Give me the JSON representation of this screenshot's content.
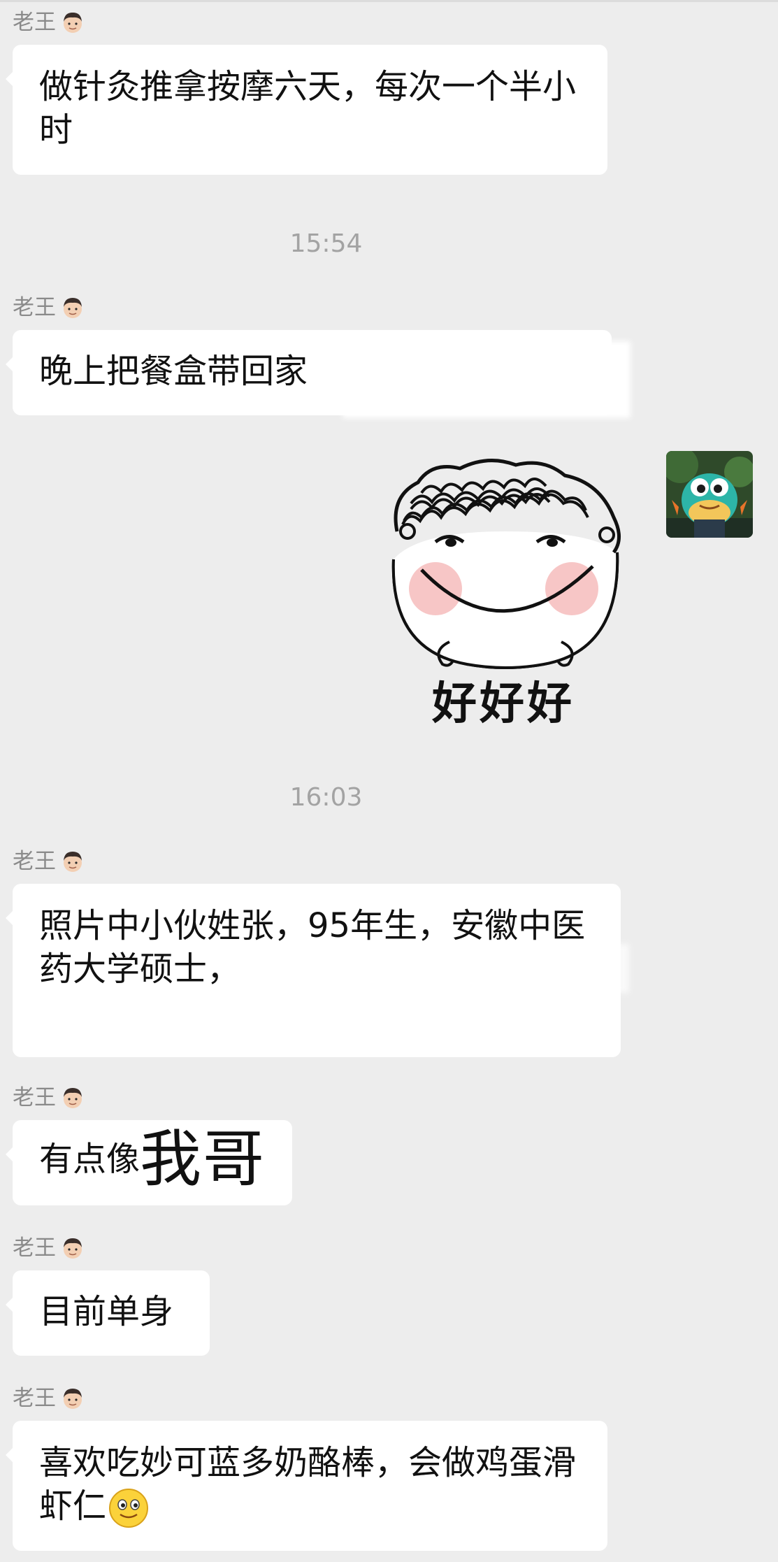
{
  "sender_name": "老王",
  "timestamps": [
    "15:54",
    "16:03"
  ],
  "messages": {
    "m1": "做针灸推拿按摩六天，每次一个半小时",
    "m2": "晚上把餐盒带回家",
    "m3": "照片中小伙姓张，95年生，安徽中医药大学硕士，",
    "m4_small": "有点像",
    "m4_big": "我哥",
    "m5": "目前单身",
    "m6": "喜欢吃妙可蓝多奶酪棒，会做鸡蛋滑虾仁"
  },
  "sticker_caption": "好好好",
  "icons": {
    "sender_face": "young-man-face-emoji",
    "my_avatar": "cartoon-frog-avatar",
    "inline_emoji": "slightly-smiling-face-emoji"
  },
  "colors": {
    "background": "#ededed",
    "bubble": "#ffffff",
    "sender_text": "#8a8a8a",
    "timestamp_text": "#a3a3a3",
    "message_text": "#111111"
  }
}
